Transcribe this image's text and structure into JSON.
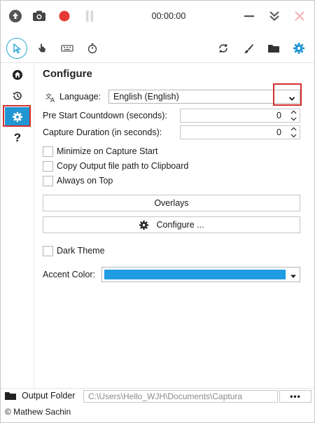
{
  "titlebar": {
    "timer": "00:00:00",
    "icons": [
      "cloud-upload-icon",
      "camera-icon",
      "record-icon",
      "pause-icon",
      "minimize-icon",
      "collapse-icon",
      "close-icon"
    ]
  },
  "toolbar": {
    "left_tools": [
      "pointer-icon",
      "hand-click-icon",
      "keyboard-icon",
      "stopwatch-icon"
    ],
    "right_tools": [
      "refresh-icon",
      "brush-icon",
      "folder-icon",
      "gear-icon"
    ]
  },
  "sidebar": {
    "items": [
      "home-icon",
      "history-icon",
      "gear-icon",
      "help-icon"
    ],
    "selected": "gear-icon",
    "help_glyph": "?"
  },
  "configure": {
    "heading": "Configure",
    "language_label": "Language:",
    "language_value": "English (English)",
    "countdown_label": "Pre Start Countdown (seconds):",
    "countdown_value": "0",
    "duration_label": "Capture Duration (in seconds):",
    "duration_value": "0",
    "checkboxes": [
      {
        "label": "Minimize on Capture Start",
        "checked": false
      },
      {
        "label": "Copy Output file path to Clipboard",
        "checked": false
      },
      {
        "label": "Always on Top",
        "checked": false
      }
    ],
    "overlays_button": "Overlays",
    "configure_button": "Configure ...",
    "dark_theme_label": "Dark Theme",
    "dark_theme_checked": false,
    "accent_label": "Accent Color:",
    "accent_color": "#1f9ce2"
  },
  "footer": {
    "output_folder_label": "Output Folder",
    "output_path": "C:\\Users\\Hello_WJH\\Documents\\Captura",
    "more_button": "•••",
    "copyright": "© Mathew Sachin"
  },
  "colors": {
    "accent": "#2196d3",
    "record_red": "#e53935",
    "highlight_red": "#d32f2f",
    "icon_dark": "#333333",
    "icon_disabled": "#c8c8c8",
    "close_disabled": "#f4b4b4"
  }
}
